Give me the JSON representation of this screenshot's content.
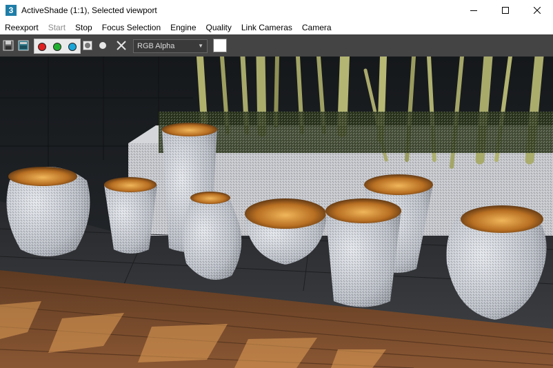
{
  "window": {
    "title": "ActiveShade (1:1), Selected viewport",
    "app_icon_label": "3"
  },
  "menu": [
    {
      "label": "Reexport",
      "enabled": true
    },
    {
      "label": "Start",
      "enabled": false
    },
    {
      "label": "Stop",
      "enabled": true
    },
    {
      "label": "Focus Selection",
      "enabled": true
    },
    {
      "label": "Engine",
      "enabled": true
    },
    {
      "label": "Quality",
      "enabled": true
    },
    {
      "label": "Link Cameras",
      "enabled": true
    },
    {
      "label": "Camera",
      "enabled": true
    }
  ],
  "toolbar": {
    "channel_select": "RGB Alpha",
    "channel_buttons": [
      {
        "name": "red-channel",
        "color": "#e02020"
      },
      {
        "name": "green-channel",
        "color": "#22b030"
      },
      {
        "name": "blue-channel",
        "color": "#1aa6d8"
      }
    ],
    "swatch_color": "#ffffff"
  },
  "colors": {
    "toolbar_bg": "#444444",
    "wall_tile": "#1e2124",
    "floor_tile": "#2b2d30",
    "wood": "#7a4a2a",
    "planter": "#c9cbd0",
    "bamboo": "#a4a766",
    "vase_body": "#c9ccd4",
    "vase_inner": "#c98a3a"
  }
}
